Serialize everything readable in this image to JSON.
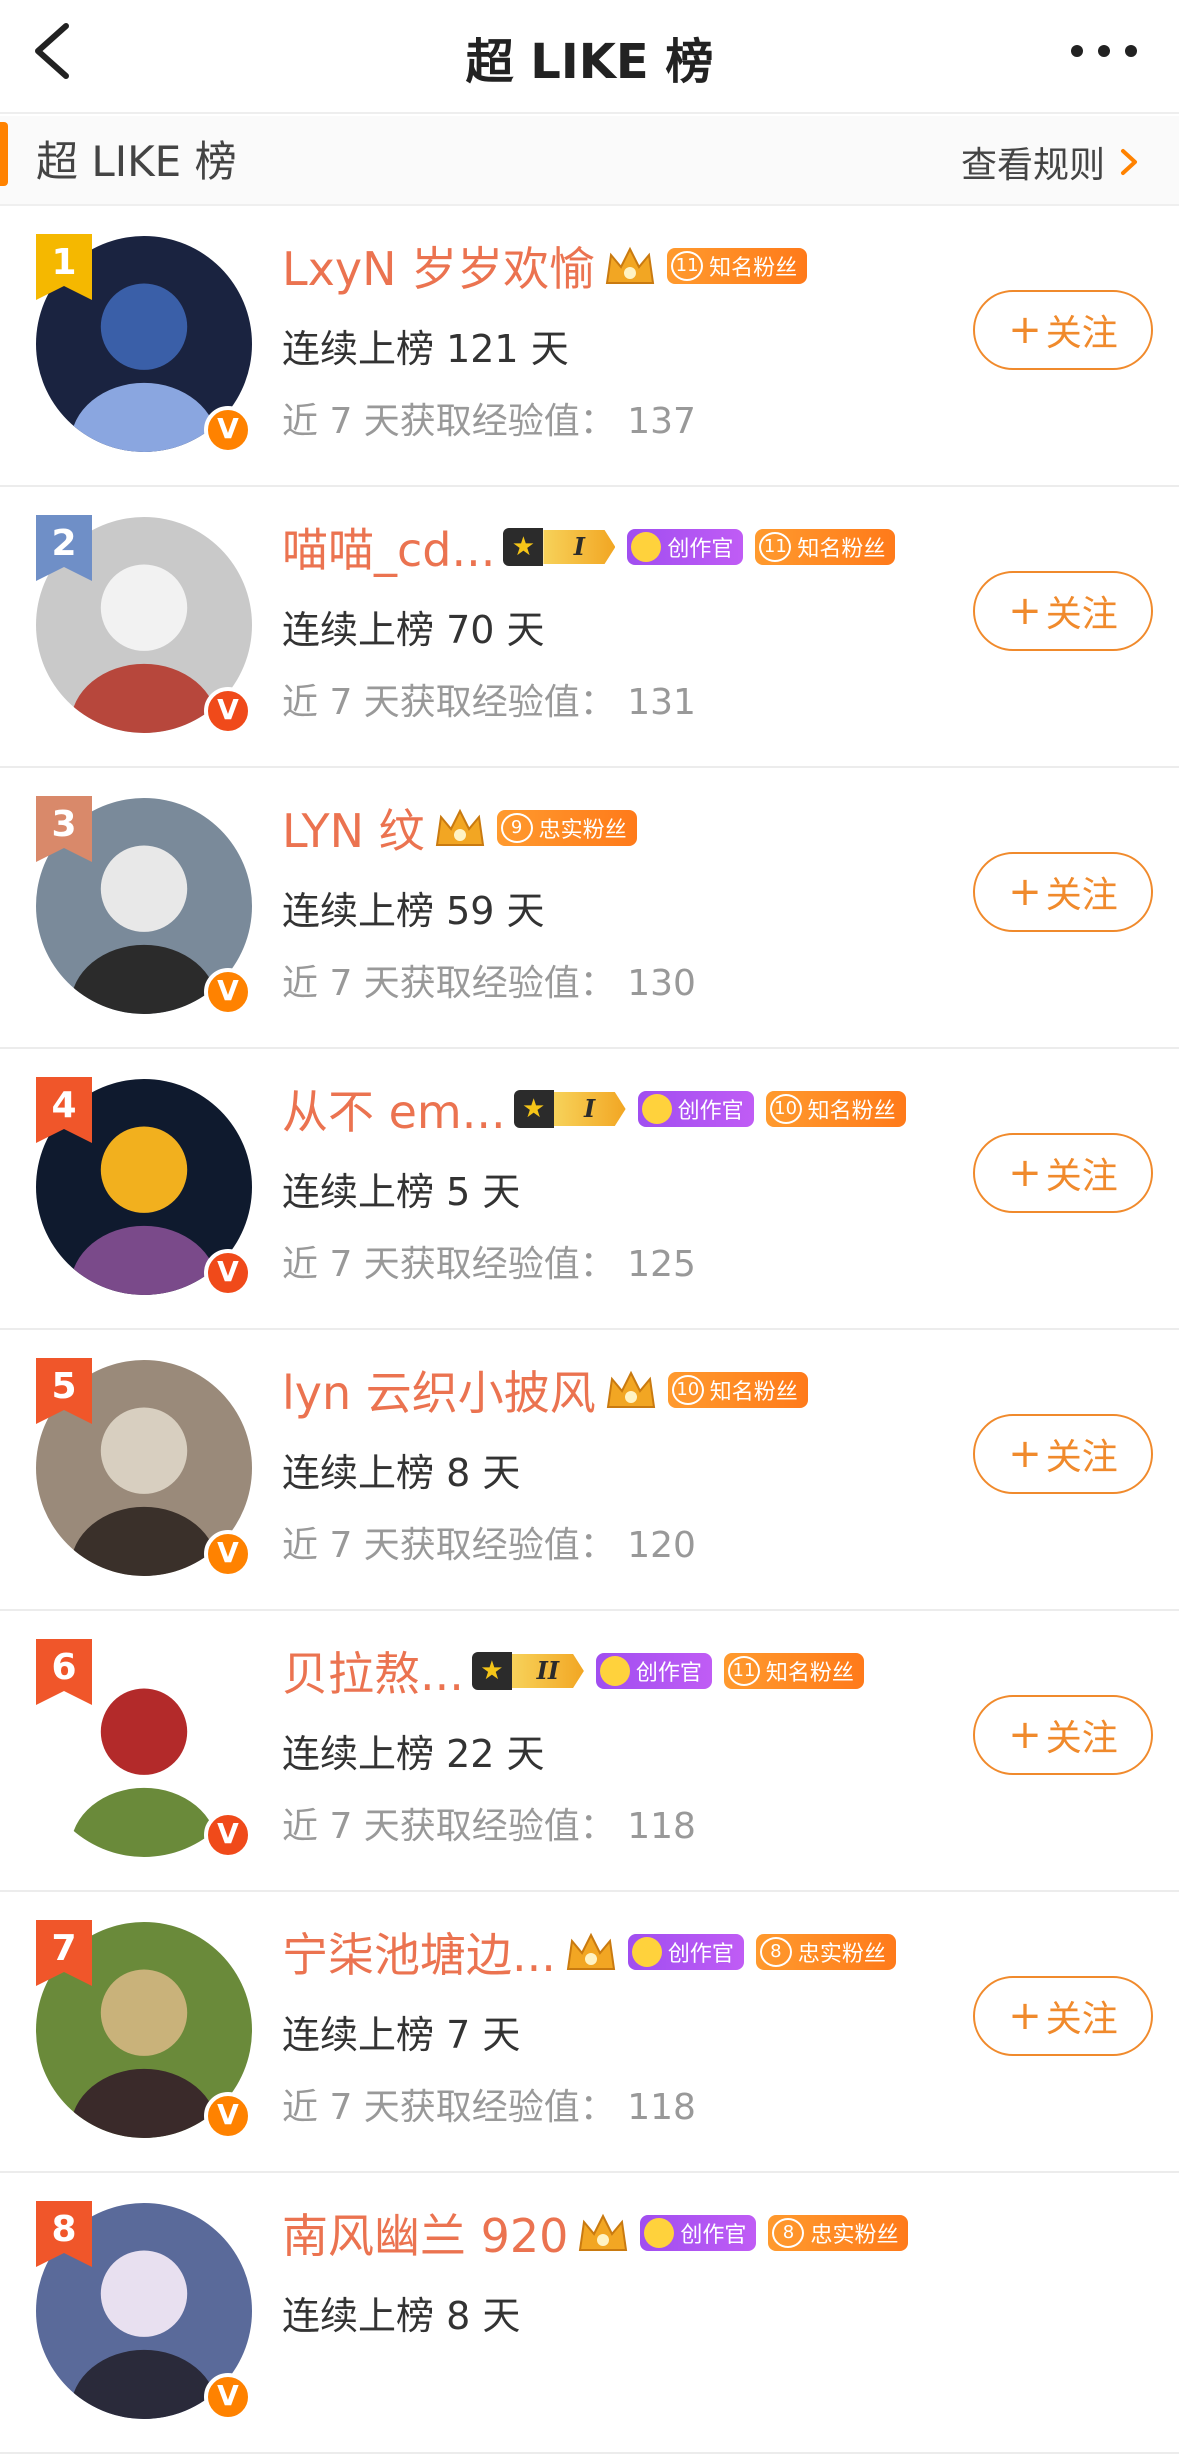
{
  "nav": {
    "title": "超 LIKE 榜"
  },
  "section": {
    "label": "超 LIKE 榜",
    "rules": "查看规则"
  },
  "colors": {
    "accent": "#ff8200",
    "name": "#eb7350",
    "creator": "#a04ef0"
  },
  "streak_prefix": "连续上榜",
  "exp_prefix": "近 7 天获取经验值：",
  "follow_label": "关注",
  "rows": [
    {
      "rank": "1",
      "name": "LxyN 岁岁欢愉",
      "level": null,
      "creator": false,
      "fan_num": "11",
      "fan_label": "知名粉丝",
      "streak": "连续上榜 121 天",
      "exp": "近 7 天获取经验值：  137"
    },
    {
      "rank": "2",
      "name": "喵喵_cd...",
      "level": "I",
      "creator": true,
      "creator_label": "创作官",
      "fan_num": "11",
      "fan_label": "知名粉丝",
      "streak": "连续上榜 70 天",
      "exp": "近 7 天获取经验值：  131"
    },
    {
      "rank": "3",
      "name": "LYN 纹",
      "level": null,
      "creator": false,
      "fan_num": "9",
      "fan_label": "忠实粉丝",
      "streak": "连续上榜 59 天",
      "exp": "近 7 天获取经验值：  130"
    },
    {
      "rank": "4",
      "name": "从不 em...",
      "level": "I",
      "creator": true,
      "creator_label": "创作官",
      "fan_num": "10",
      "fan_label": "知名粉丝",
      "streak": "连续上榜 5 天",
      "exp": "近 7 天获取经验值：  125"
    },
    {
      "rank": "5",
      "name": "lyn 云织小披风",
      "level": null,
      "creator": false,
      "fan_num": "10",
      "fan_label": "知名粉丝",
      "streak": "连续上榜 8 天",
      "exp": "近 7 天获取经验值：  120"
    },
    {
      "rank": "6",
      "name": "贝拉熬...",
      "level": "II",
      "creator": true,
      "creator_label": "创作官",
      "fan_num": "11",
      "fan_label": "知名粉丝",
      "streak": "连续上榜 22 天",
      "exp": "近 7 天获取经验值：  118"
    },
    {
      "rank": "7",
      "name": "宁柒池塘边...",
      "level": null,
      "creator": true,
      "creator_label": "创作官",
      "fan_num": "8",
      "fan_label": "忠实粉丝",
      "streak": "连续上榜 7 天",
      "exp": "近 7 天获取经验值：  118"
    },
    {
      "rank": "8",
      "name": "南风幽兰 920",
      "level": null,
      "creator": true,
      "creator_label": "创作官",
      "fan_num": "8",
      "fan_label": "忠实粉丝",
      "streak": "连续上榜 8 天",
      "exp": ""
    }
  ]
}
